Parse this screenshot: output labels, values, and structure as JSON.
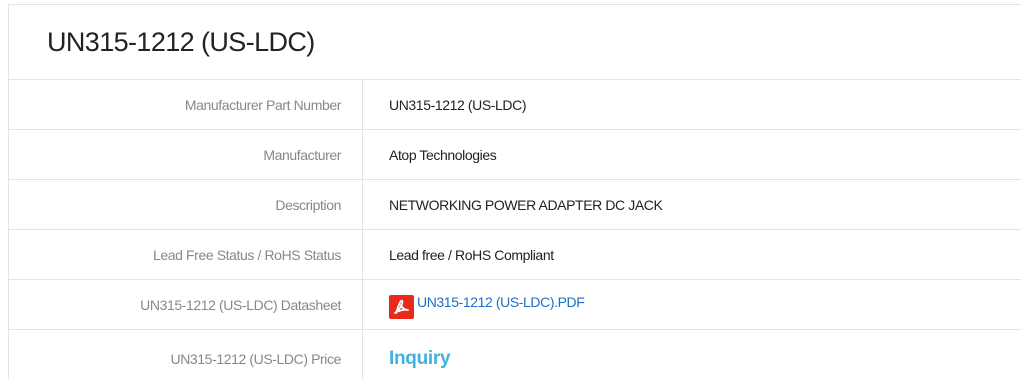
{
  "title": "UN315-1212 (US-LDC)",
  "rows": [
    {
      "label": "Manufacturer Part Number",
      "value": "UN315-1212 (US-LDC)"
    },
    {
      "label": "Manufacturer",
      "value": "Atop Technologies"
    },
    {
      "label": "Description",
      "value": "NETWORKING POWER ADAPTER DC JACK"
    },
    {
      "label": "Lead Free Status / RoHS Status",
      "value": "Lead free / RoHS Compliant"
    },
    {
      "label": "UN315-1212 (US-LDC) Datasheet",
      "value": "UN315-1212 (US-LDC).PDF"
    },
    {
      "label": "UN315-1212 (US-LDC) Price",
      "value": "Inquiry"
    }
  ],
  "icons": {
    "datasheet": "pdf-file-icon"
  },
  "colors": {
    "link": "#1e6fc4",
    "inquiry": "#3fb3e0",
    "pdf_icon": "#e8291c",
    "label": "#888888",
    "border": "#e3e3e3"
  }
}
